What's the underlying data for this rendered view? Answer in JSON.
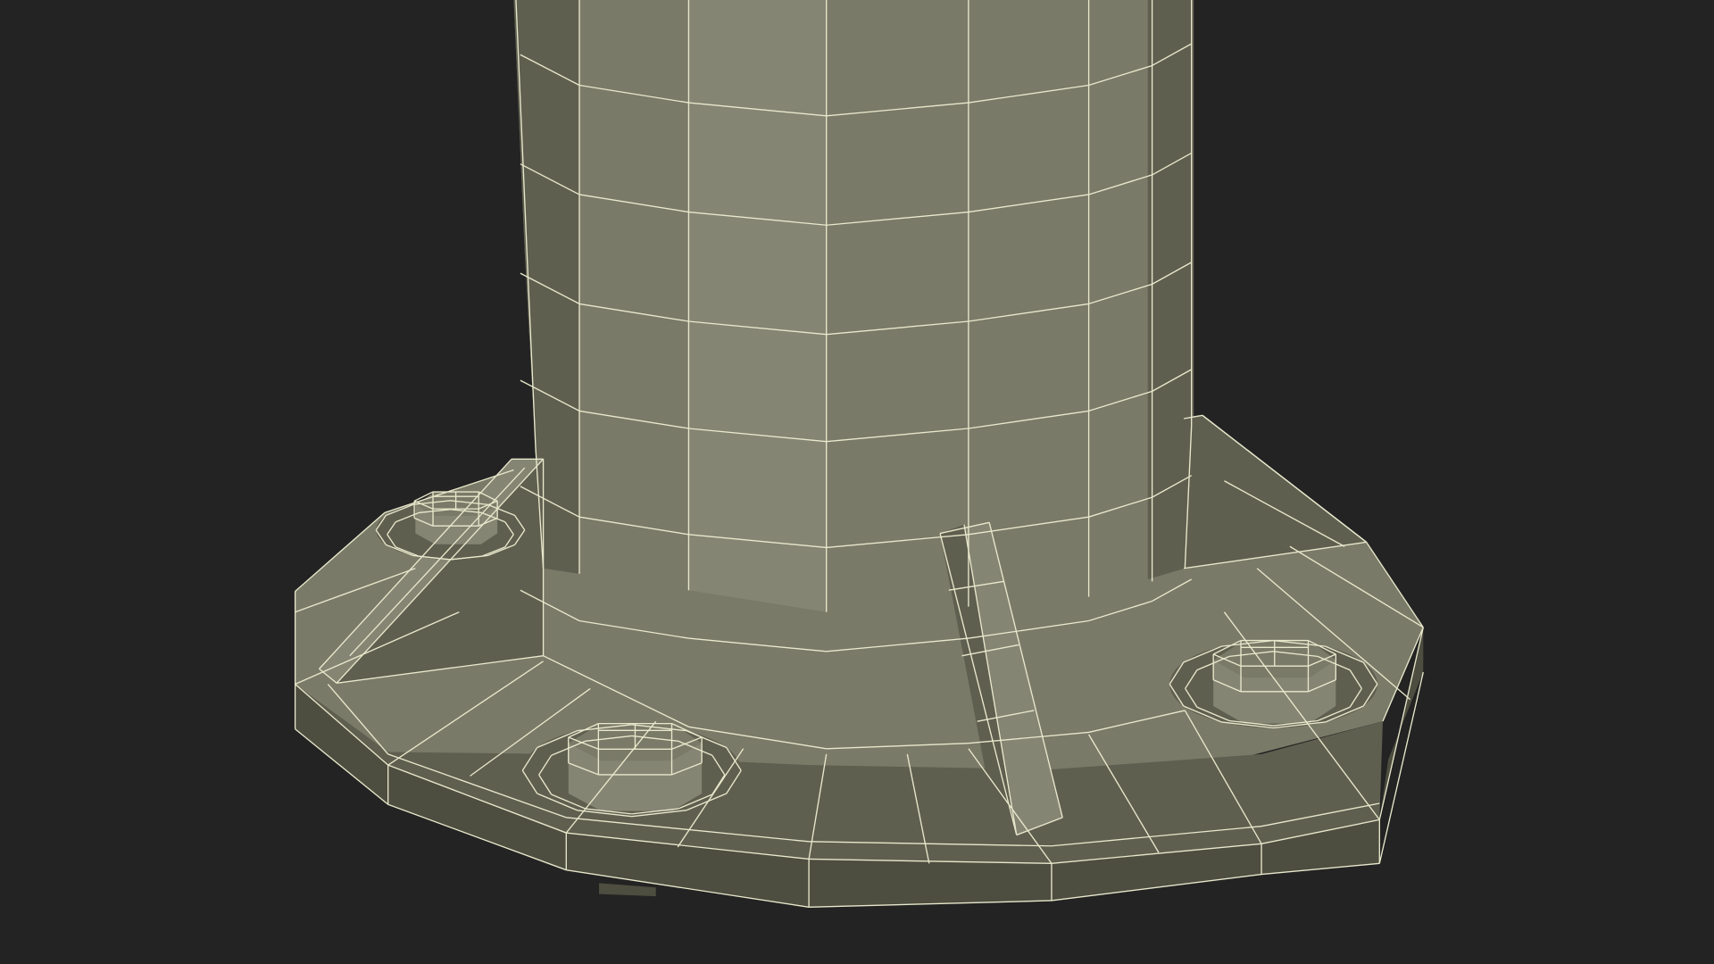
{
  "scene": {
    "subject": "wireframe-render",
    "colors": {
      "background": "#232323",
      "surface": "#7a7a68",
      "surface_light": "#858574",
      "surface_dark": "#5f5f50",
      "surface_shadow": "#4d4d40",
      "wire": "#e8e8cc"
    }
  }
}
